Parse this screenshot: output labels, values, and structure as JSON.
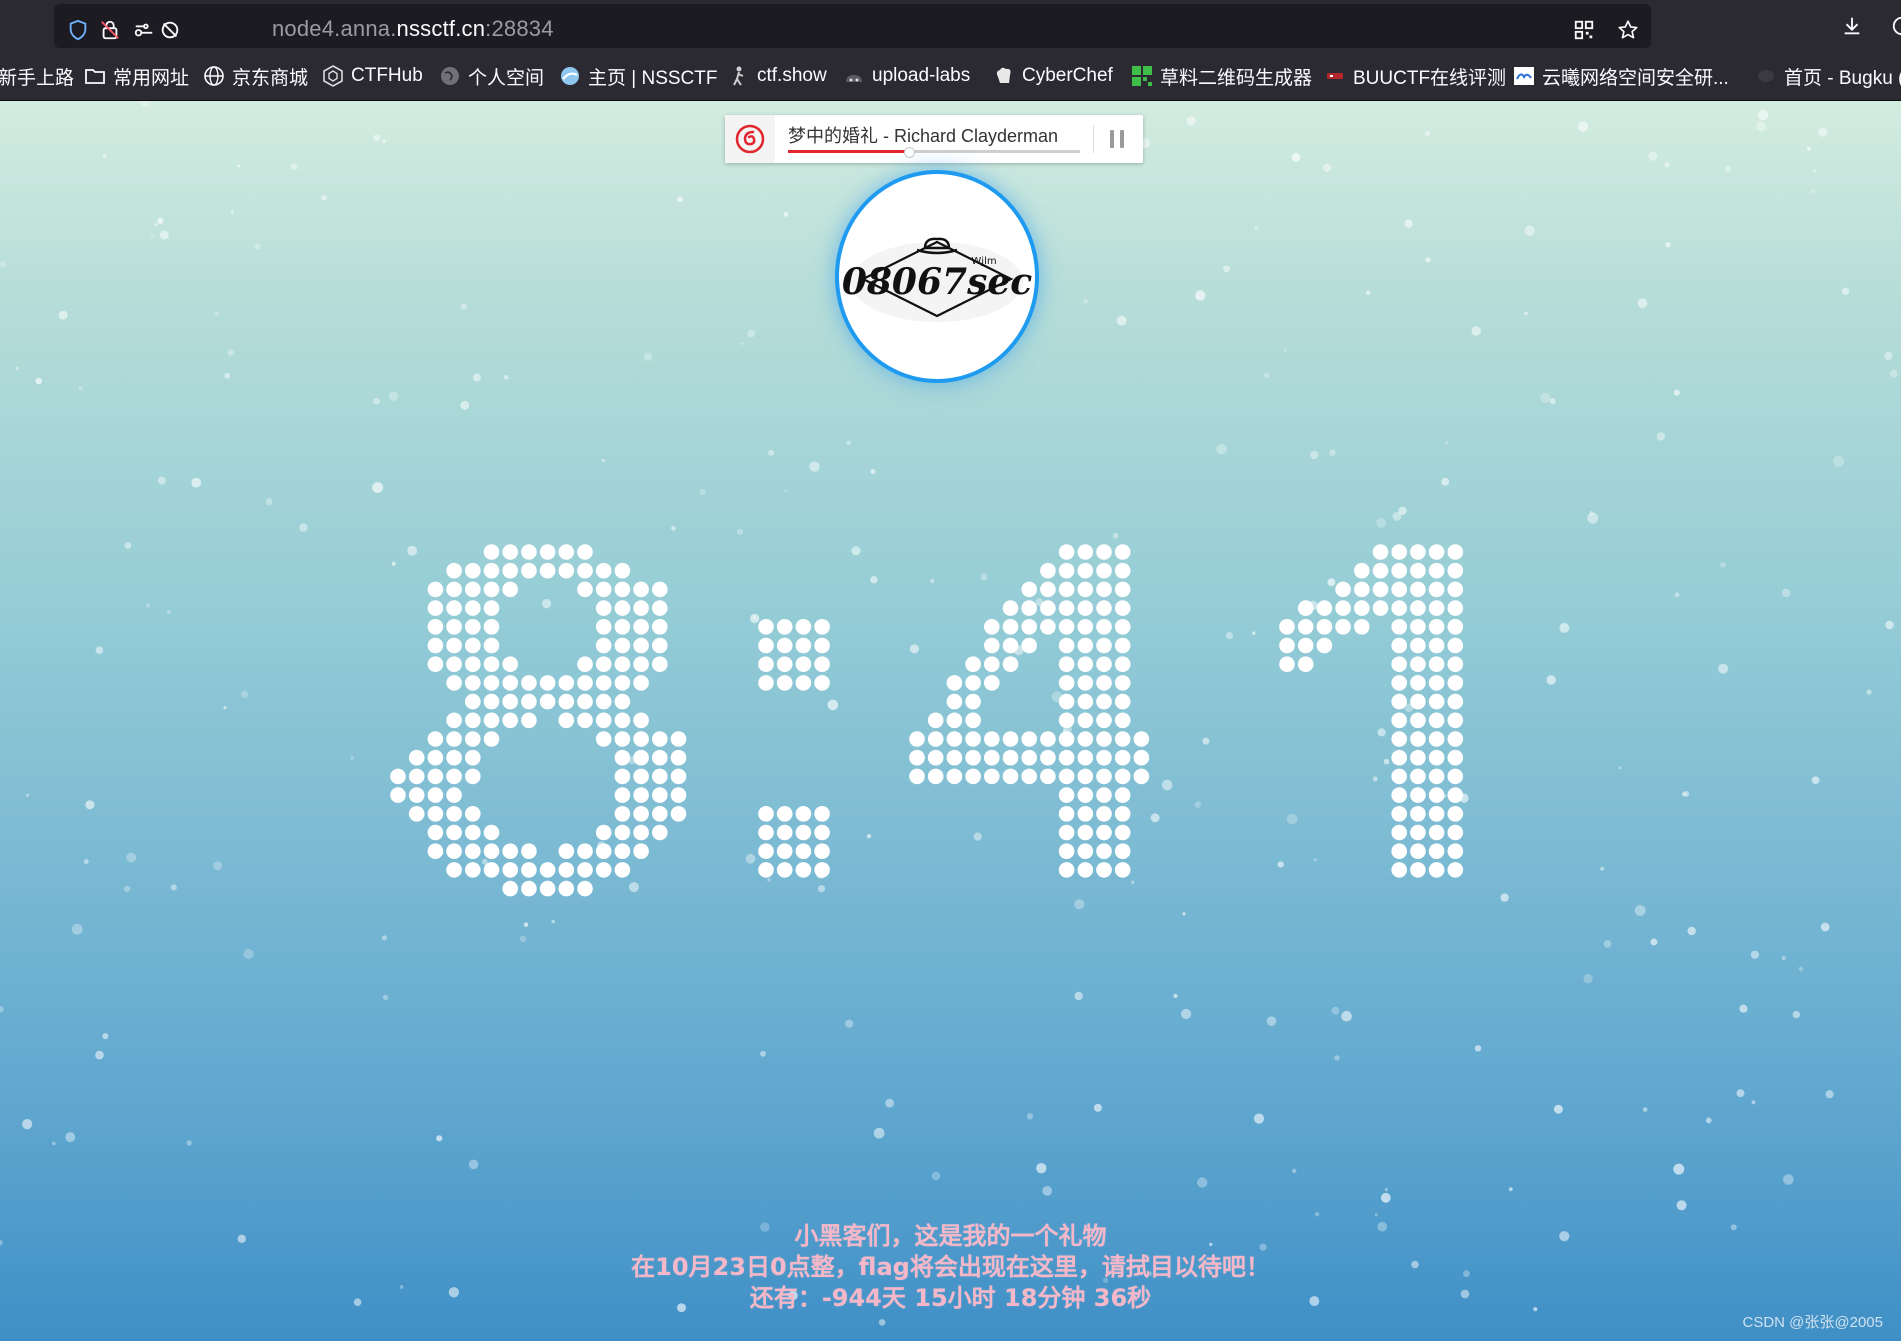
{
  "browser": {
    "url_prefix": "node4.anna.",
    "url_host": "nssctf.cn",
    "url_port": ":28834",
    "bookmarks": [
      {
        "label": "新手上路",
        "icon": "none"
      },
      {
        "label": "常用网址",
        "icon": "folder-icon"
      },
      {
        "label": "京东商城",
        "icon": "globe-icon"
      },
      {
        "label": "CTFHub",
        "icon": "ctfhub-icon"
      },
      {
        "label": "个人空间",
        "icon": "globe-gray-icon"
      },
      {
        "label": "主页 | NSSCTF",
        "icon": "nssctf-icon"
      },
      {
        "label": "ctf.show",
        "icon": "ctfshow-icon"
      },
      {
        "label": "upload-labs",
        "icon": "upload-icon"
      },
      {
        "label": "CyberChef",
        "icon": "chef-icon"
      },
      {
        "label": "草料二维码生成器",
        "icon": "qr-icon"
      },
      {
        "label": "BUUCTF在线评测",
        "icon": "buu-icon"
      },
      {
        "label": "云曦网络空间安全研...",
        "icon": "yunxi-icon"
      },
      {
        "label": "首页 - Bugku (",
        "icon": "bugku-icon"
      }
    ]
  },
  "player": {
    "song": "梦中的婚礼 - Richard Clayderman",
    "progress": 0.41,
    "state": "playing"
  },
  "avatar": {
    "logo_text": "08067sec",
    "logo_tag": "Wjlm"
  },
  "clock": {
    "display": "8:41"
  },
  "message": {
    "line1": "小黑客们，这是我的一个礼物",
    "line2": "在10月23日0点整，flag将会出现在这里，请拭目以待吧！",
    "line3": "还有：-944天 15小时 18分钟 36秒"
  },
  "watermark": "CSDN @张张@2005",
  "colors": {
    "accent_blue": "#1e9bf0",
    "netease_red": "#e0262e",
    "message_pink": "#f6b8c8"
  }
}
